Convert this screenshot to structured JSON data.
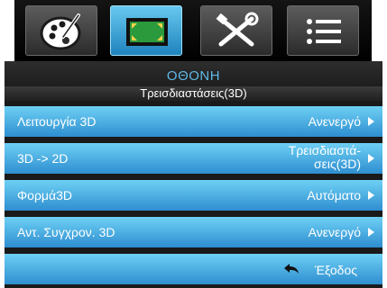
{
  "tabs": [
    {
      "id": "image",
      "icon": "palette-icon",
      "active": false
    },
    {
      "id": "display",
      "icon": "display-screen-icon",
      "active": true
    },
    {
      "id": "setup",
      "icon": "tools-icon",
      "active": false
    },
    {
      "id": "options",
      "icon": "list-icon",
      "active": false
    }
  ],
  "menu": {
    "title": "ΟΘΟΝΗ",
    "subtitle": "Τρεισδιαστάσεις(3D)",
    "rows": [
      {
        "label": "Λειτουργία 3D",
        "value": "Ανενεργό"
      },
      {
        "label": "3D -> 2D",
        "value_line1": "Τρεισδιαστά-",
        "value_line2": "σεις(3D)"
      },
      {
        "label": "Φορμά3D",
        "value": "Αυτόματο"
      },
      {
        "label": "Αντ. Συγχρον. 3D",
        "value": "Ανενεργό"
      }
    ],
    "exit_label": "Έξοδος"
  },
  "colors": {
    "accent_title": "#5fb8e6",
    "row_top": "#6ed0f4",
    "row_bottom": "#2e8ed0",
    "panel_bg": "#1a1a1a"
  }
}
